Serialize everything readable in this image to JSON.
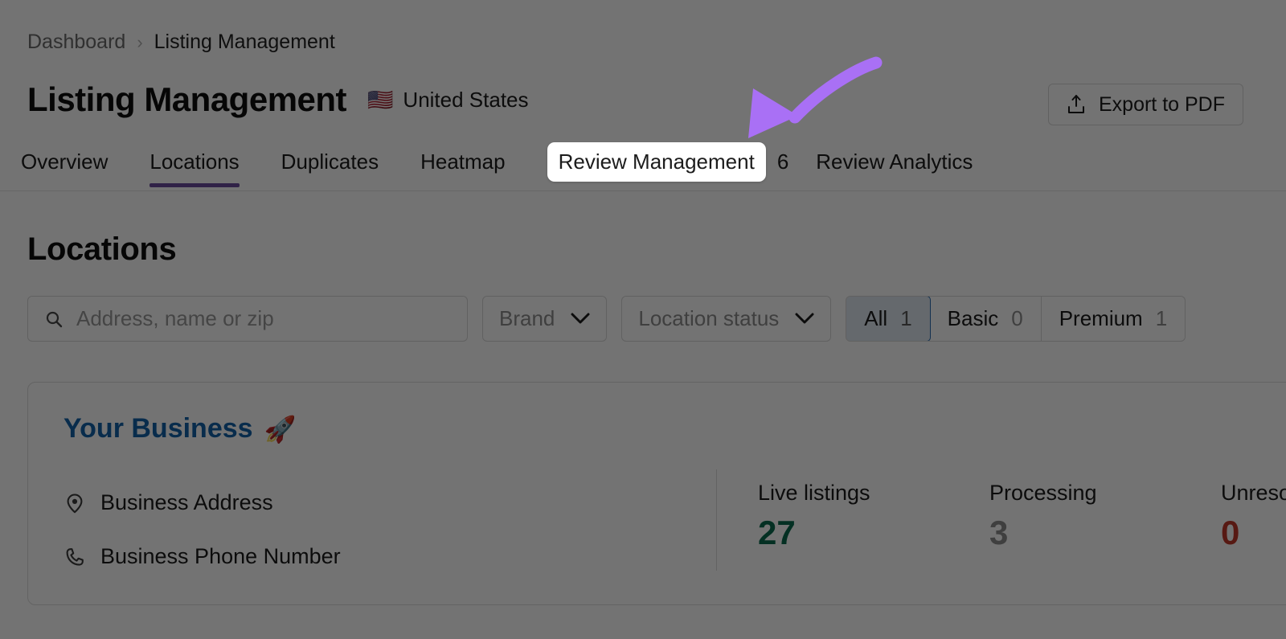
{
  "breadcrumb": {
    "items": [
      "Dashboard",
      "Listing Management"
    ],
    "separator": "›"
  },
  "header": {
    "title": "Listing Management",
    "country": "United States",
    "flag_icon": "us-flag",
    "flag_glyph": "🇺🇸",
    "export_label": "Export to PDF",
    "export_icon": "export-upload-icon"
  },
  "tabs": {
    "items": [
      {
        "label": "Overview",
        "active": false
      },
      {
        "label": "Locations",
        "active": true
      },
      {
        "label": "Duplicates",
        "active": false
      },
      {
        "label": "Heatmap",
        "active": false
      },
      {
        "label": "Review Management",
        "active": false,
        "highlighted": true
      },
      {
        "label": "Review Analytics",
        "active": false
      }
    ],
    "review_management_count": "6",
    "active_underline_color": "#6b4d9e"
  },
  "section": {
    "title": "Locations"
  },
  "filters": {
    "search": {
      "placeholder": "Address, name or zip",
      "value": "",
      "icon": "search-icon"
    },
    "brand": {
      "label": "Brand",
      "icon": "chevron-down-icon"
    },
    "location_status": {
      "label": "Location status",
      "icon": "chevron-down-icon"
    },
    "segments": [
      {
        "label": "All",
        "count": "1",
        "selected": true
      },
      {
        "label": "Basic",
        "count": "0",
        "selected": false
      },
      {
        "label": "Premium",
        "count": "1",
        "selected": false
      }
    ],
    "selected_segment_color": "#2b6cb0"
  },
  "business_card": {
    "name": "Your Business",
    "name_color": "#1262a9",
    "emoji": "🚀",
    "emoji_name": "rocket-emoji",
    "address_label": "Business Address",
    "address_icon": "location-pin-icon",
    "phone_label": "Business Phone Number",
    "phone_icon": "phone-icon",
    "stats": [
      {
        "label": "Live listings",
        "value": "27",
        "tone": "green"
      },
      {
        "label": "Processing",
        "value": "3",
        "tone": "gray"
      },
      {
        "label": "Unresolved",
        "value": "0",
        "tone": "red"
      }
    ],
    "stat_colors": {
      "green": "#0b6b4f",
      "gray": "#8c8c8c",
      "red": "#c0392b"
    }
  },
  "annotation": {
    "type": "curved-arrow",
    "color": "#a970f5",
    "points_to": "Review Management"
  }
}
